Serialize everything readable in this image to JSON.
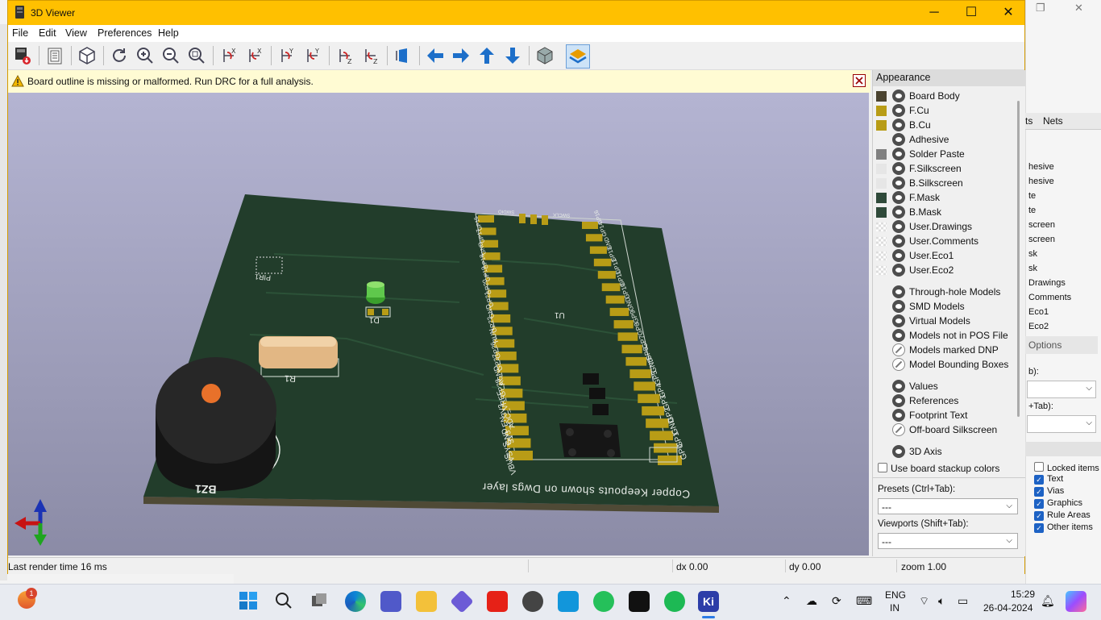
{
  "background_app": {
    "right_panel_lines": [
      "hesive",
      "hesive",
      "te",
      "te",
      "screen",
      "screen",
      "sk",
      "sk",
      "Drawings",
      "Comments",
      "Eco1",
      "Eco2"
    ],
    "tabs": [
      "ts",
      "Nets"
    ],
    "options_label": "Options",
    "presets_fragment": "b):",
    "viewports_fragment": "+Tab):",
    "checks": [
      {
        "label": "Locked items",
        "checked": false
      },
      {
        "label": "Text",
        "checked": true
      },
      {
        "label": "Vias",
        "checked": true
      },
      {
        "label": "Graphics",
        "checked": true
      },
      {
        "label": "Rule Areas",
        "checked": true
      },
      {
        "label": "Other items",
        "checked": true
      }
    ]
  },
  "window": {
    "title": "3D Viewer",
    "controls": {
      "minimize": "─",
      "maximize": "☐",
      "close": "✕"
    }
  },
  "menu": [
    "File",
    "Edit",
    "View",
    "Preferences",
    "Help"
  ],
  "toolbar": {
    "icons": [
      "export-image-icon",
      "copy-clipboard-icon",
      "view-3d-icon",
      "reload-icon",
      "zoom-in-icon",
      "zoom-out-icon",
      "zoom-fit-icon",
      "rotate-x-cw-icon",
      "rotate-x-ccw-icon",
      "rotate-y-cw-icon",
      "rotate-y-ccw-icon",
      "rotate-z-cw-icon",
      "rotate-z-ccw-icon",
      "flip-board-icon",
      "move-left-icon",
      "move-right-icon",
      "move-up-icon",
      "move-down-icon",
      "orthographic-icon",
      "layers-manager-icon"
    ]
  },
  "infobar": {
    "message": "Board outline is missing or malformed. Run DRC for a full analysis."
  },
  "board": {
    "silk_texts": {
      "bz1": "BZ1",
      "r1": "R1",
      "d1": "D1",
      "pir1": "PIR1",
      "u1": "U1",
      "note": "Copper Keepouts shown on Dwgs layer",
      "swdio": "SWDIO",
      "swclk": "SWCLK"
    },
    "left_pins": [
      "GP15",
      "GP17",
      "GND",
      "GP18",
      "GP19",
      "GP20",
      "GP21",
      "GND",
      "GP22",
      "RUN",
      "GP26",
      "GP27",
      "AGND",
      "GP28",
      "ADC_VREF",
      "3V3",
      "3V3_EN",
      "GND",
      "VSYS",
      "VBUS"
    ],
    "right_pins": [
      "GP16",
      "GP14",
      "GND",
      "GP13",
      "GP12",
      "GP11",
      "GP10",
      "GND",
      "GP9",
      "GP8",
      "GP7",
      "GP6",
      "GND",
      "GP5",
      "GP4",
      "GP3",
      "GP2",
      "GND",
      "GP1",
      "GP0"
    ]
  },
  "appearance": {
    "title": "Appearance",
    "layers": [
      {
        "name": "Board Body",
        "color": "#4a4330",
        "visible": true
      },
      {
        "name": "F.Cu",
        "color": "#b89c16",
        "visible": true
      },
      {
        "name": "B.Cu",
        "color": "#b89c16",
        "visible": true
      },
      {
        "name": "Adhesive",
        "color": "",
        "visible": true
      },
      {
        "name": "Solder Paste",
        "color": "#808080",
        "visible": true
      },
      {
        "name": "F.Silkscreen",
        "color": "#e6e6e6",
        "visible": true
      },
      {
        "name": "B.Silkscreen",
        "color": "#e6e6e6",
        "visible": true
      },
      {
        "name": "F.Mask",
        "color": "#2f4a3a",
        "visible": true
      },
      {
        "name": "B.Mask",
        "color": "#2f4a3a",
        "visible": true
      },
      {
        "name": "User.Drawings",
        "color": "checker",
        "visible": true
      },
      {
        "name": "User.Comments",
        "color": "checker",
        "visible": true
      },
      {
        "name": "User.Eco1",
        "color": "checker",
        "visible": true
      },
      {
        "name": "User.Eco2",
        "color": "checker",
        "visible": true
      }
    ],
    "models": [
      {
        "name": "Through-hole Models",
        "visible": true
      },
      {
        "name": "SMD Models",
        "visible": true
      },
      {
        "name": "Virtual Models",
        "visible": true
      },
      {
        "name": "Models not in POS File",
        "visible": true
      },
      {
        "name": "Models marked DNP",
        "visible": false
      },
      {
        "name": "Model Bounding Boxes",
        "visible": false
      }
    ],
    "extras": [
      {
        "name": "Values",
        "visible": true
      },
      {
        "name": "References",
        "visible": true
      },
      {
        "name": "Footprint Text",
        "visible": true
      },
      {
        "name": "Off-board Silkscreen",
        "visible": false
      }
    ],
    "axis": {
      "name": "3D Axis",
      "visible": true
    },
    "use_stackup_label": "Use board stackup colors",
    "presets_label": "Presets (Ctrl+Tab):",
    "presets_value": "---",
    "viewports_label": "Viewports (Shift+Tab):",
    "viewports_value": "---"
  },
  "status": {
    "render_time": "Last render time 16 ms",
    "dx": "dx 0.00",
    "dy": "dy 0.00",
    "zoom": "zoom 1.00"
  },
  "taskbar": {
    "badge": "1",
    "language": "ENG",
    "region": "IN",
    "time": "15:29",
    "date": "26-04-2024"
  }
}
